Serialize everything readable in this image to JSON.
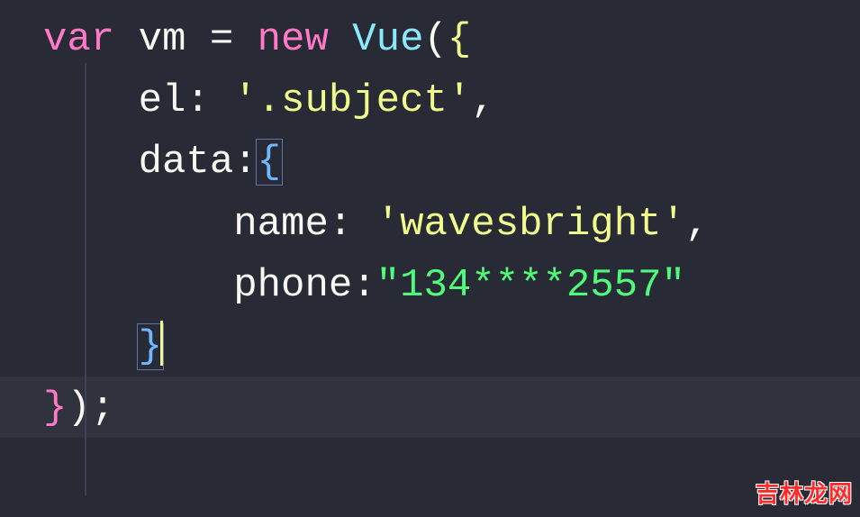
{
  "code": {
    "line1": {
      "var_kw": "var",
      "vm": " vm ",
      "eq": "=",
      "new_kw": " new ",
      "vue": "Vue",
      "open_paren": "(",
      "open_brace": "{"
    },
    "line2": {
      "indent": "    ",
      "prop": "el",
      "colon": ": ",
      "value": "'.subject'",
      "comma": ","
    },
    "line3": {
      "indent": "    ",
      "prop": "data",
      "colon": ":",
      "open_brace": "{"
    },
    "line4": {
      "indent": "        ",
      "prop": "name",
      "colon": ": ",
      "value": "'wavesbright'",
      "comma": ","
    },
    "line5": {
      "indent": "        ",
      "prop": "phone",
      "colon": ":",
      "value": "\"134****2557\""
    },
    "line6": {
      "indent": "    ",
      "close_brace": "}"
    },
    "line7": {
      "close_brace": "}",
      "close_paren": ")",
      "semi": ";"
    }
  },
  "watermark": "吉林龙网"
}
